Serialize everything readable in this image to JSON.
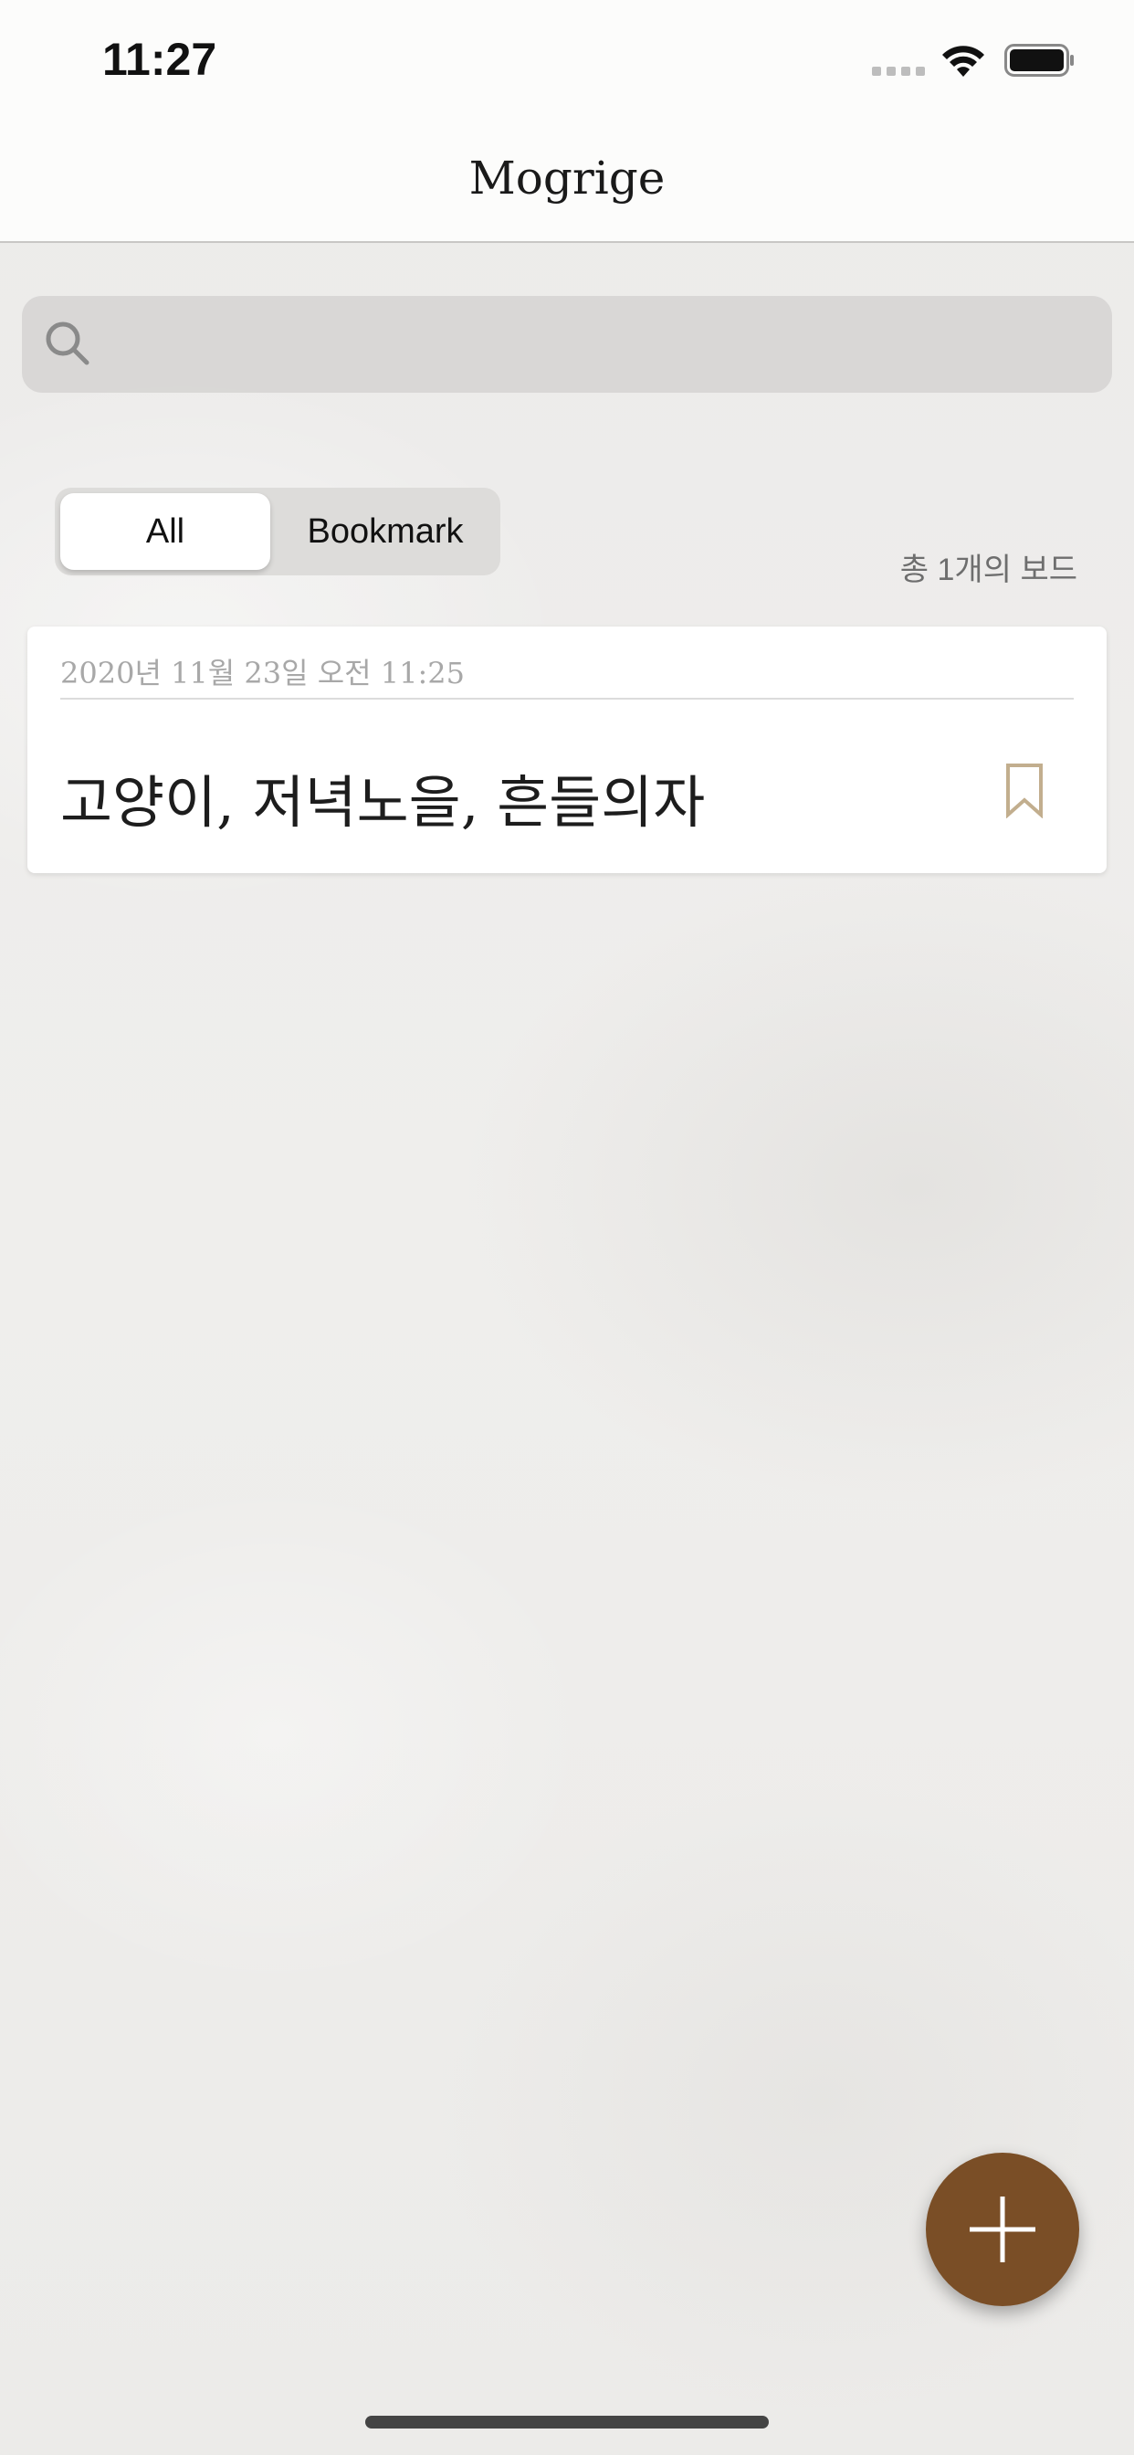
{
  "status_bar": {
    "time": "11:27"
  },
  "nav": {
    "title": "Mogrige"
  },
  "search": {
    "placeholder": "",
    "value": ""
  },
  "segments": {
    "items": [
      "All",
      "Bookmark"
    ],
    "selected": "All"
  },
  "board_count": "총 1개의 보드",
  "boards": [
    {
      "date": "2020년 11월 23일 오전 11:25",
      "title": "고양이, 저녁노을, 흔들의자",
      "bookmarked": false
    }
  ],
  "colors": {
    "accent": "#7a4e26",
    "bookmark_icon": "#c2ae8e",
    "background": "#eeedeb"
  },
  "icons": {
    "search": "search-icon",
    "bookmark": "bookmark-icon",
    "add": "plus-icon",
    "wifi": "wifi-icon",
    "battery": "battery-icon"
  }
}
